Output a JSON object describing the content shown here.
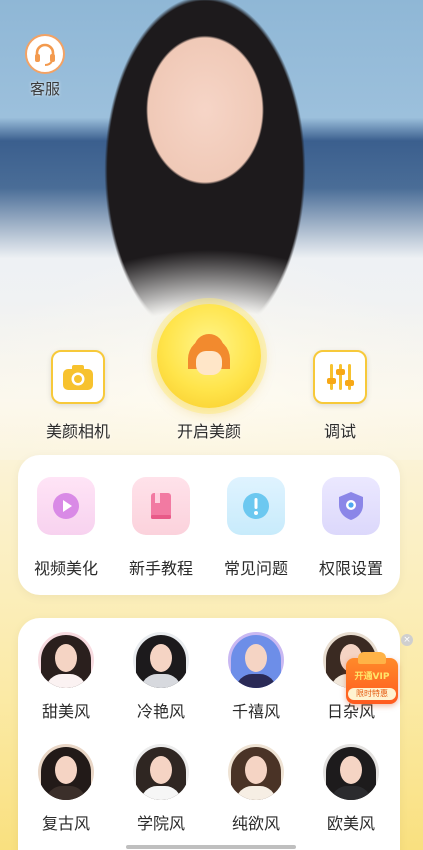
{
  "service": {
    "label": "客服",
    "icon": "headset-icon"
  },
  "actions": {
    "camera": {
      "label": "美颜相机",
      "icon": "camera-icon"
    },
    "beauty": {
      "label": "开启美颜",
      "icon": "face-icon"
    },
    "adjust": {
      "label": "调试",
      "icon": "sliders-icon"
    }
  },
  "features": [
    {
      "label": "视频美化",
      "icon": "play-icon"
    },
    {
      "label": "新手教程",
      "icon": "book-icon"
    },
    {
      "label": "常见问题",
      "icon": "exclamation-icon"
    },
    {
      "label": "权限设置",
      "icon": "shield-icon"
    }
  ],
  "styles": [
    {
      "label": "甜美风"
    },
    {
      "label": "冷艳风"
    },
    {
      "label": "千禧风"
    },
    {
      "label": "日杂风"
    },
    {
      "label": "复古风"
    },
    {
      "label": "学院风"
    },
    {
      "label": "纯欲风"
    },
    {
      "label": "欧美风"
    }
  ],
  "vip": {
    "top": "开通VIP",
    "bottom": "限时特惠"
  },
  "colors": {
    "accent": "#f7c93a",
    "service_ring": "#f3a264",
    "vip": "#ff6a22"
  }
}
